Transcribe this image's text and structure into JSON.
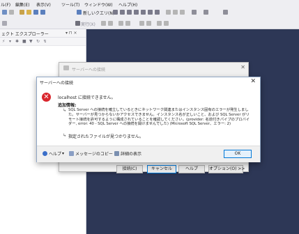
{
  "menu": {
    "items": [
      "ル(F)",
      "編集(E)",
      "表示(V)",
      "ツール(T)",
      "ウィンドウ(W)",
      "ヘルプ(H)"
    ]
  },
  "toolbar": {
    "new_query_label": "新しいクエリ(N)",
    "execute_label": "実行(X)"
  },
  "explorer": {
    "title": "ェクト エクスプローラー",
    "pin": "▾ ⊓ ×"
  },
  "back_dialog": {
    "title": "サーバーへの接続",
    "buttons": {
      "connect": "接続(C)",
      "cancel": "キャンセル",
      "help": "ヘルプ",
      "options": "オプション(O) >>"
    }
  },
  "error_dialog": {
    "title": "サーバーへの接続",
    "message": "localhost に接続できません。",
    "additional_info_label": "追加情報:",
    "detail_text": "SQL Server への接続を確立しているときにネットワーク関連またはインスタンス固有のエラーが発生しました。サーバーが見つからないかアクセスできません。インスタンス名が正しいこと、および SQL Server がリモート接続を許可するように構成されていることを確認してください。(provider: 名前付きパイプのプロバイダー, error: 40 - SQL Server への接続を開けませんでした) (Microsoft SQL Server、エラー: 2)",
    "inner_error": "指定されたファイルが見つかりません。",
    "footer": {
      "help_label": "ヘルプ",
      "copy_message_label": "メッセージのコピー",
      "show_details_label": "詳細の表示",
      "ok_label": "OK"
    }
  },
  "colors": {
    "workspace": "#2d3756",
    "error_red": "#d9262d",
    "accent": "#0078d7"
  }
}
